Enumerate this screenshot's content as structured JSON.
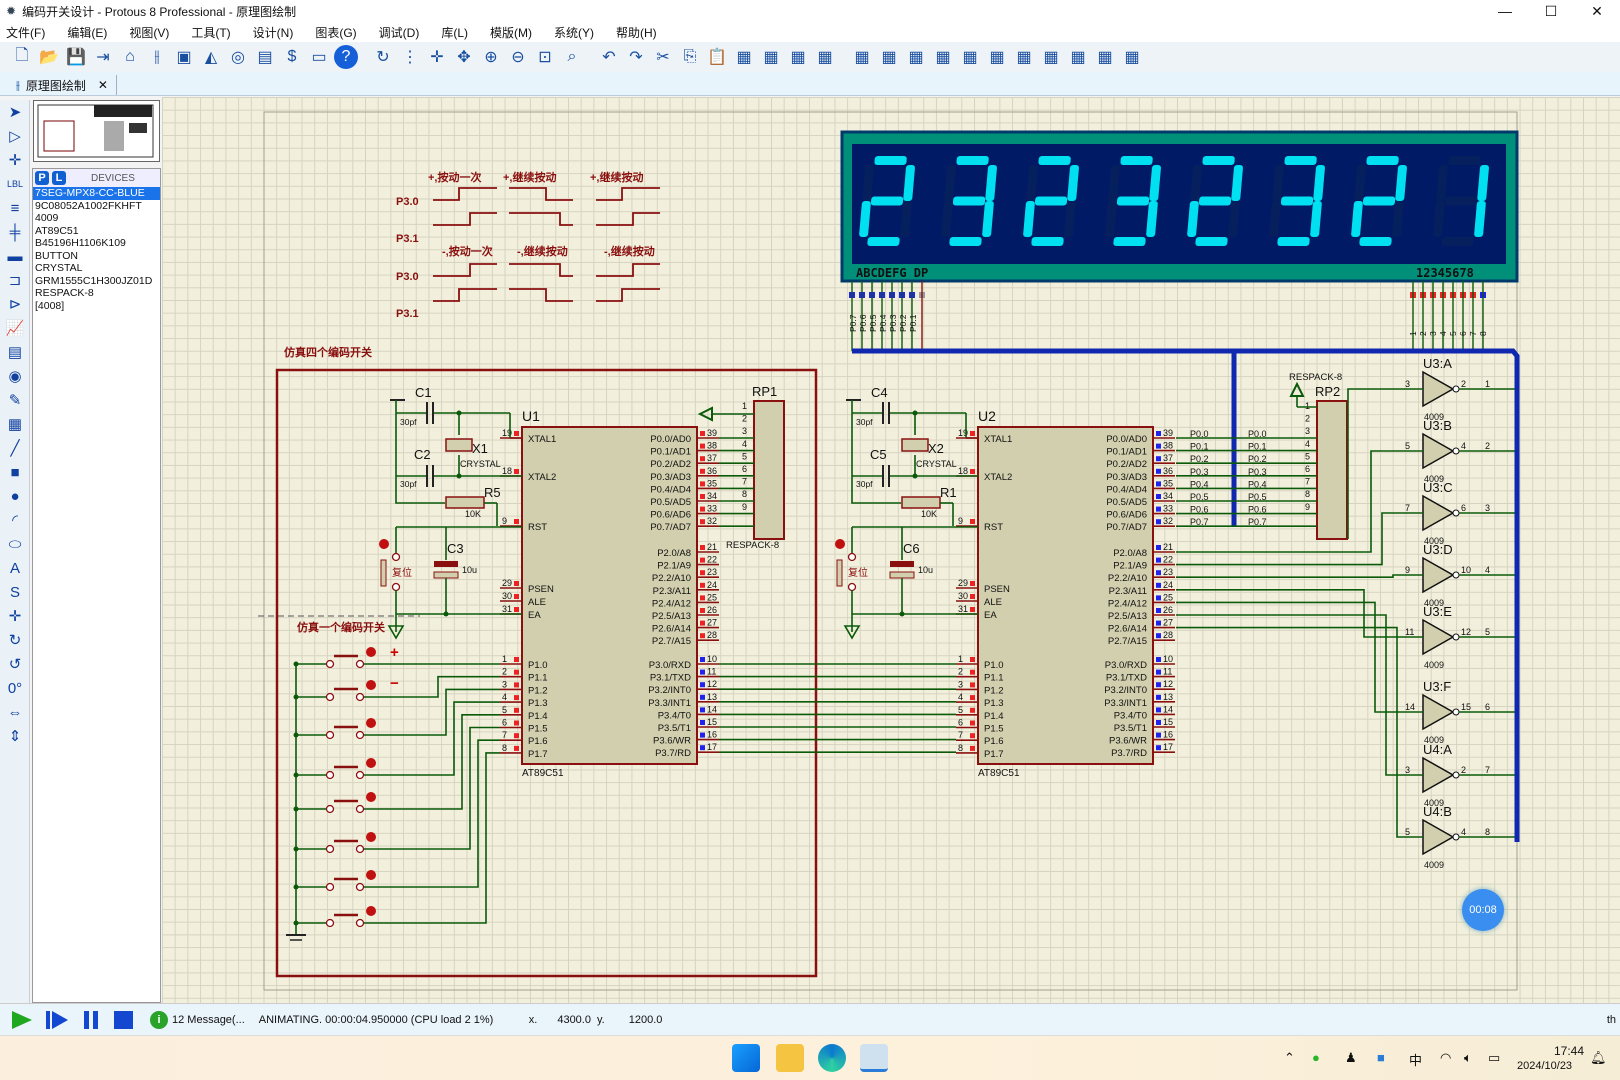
{
  "window": {
    "title": "编码开关设计 - Protous 8 Professional - 原理图绘制",
    "minimize": "—",
    "maximize": "☐",
    "close": "✕"
  },
  "menu": [
    "文件(F)",
    "编辑(E)",
    "视图(V)",
    "工具(T)",
    "设计(N)",
    "图表(G)",
    "调试(D)",
    "库(L)",
    "模版(M)",
    "系统(Y)",
    "帮助(H)"
  ],
  "toolbar_icons": [
    "new-file",
    "open-folder",
    "save",
    "import",
    "home",
    "schematic",
    "pcb",
    "3d-view",
    "gerber",
    "bom",
    "design-explorer",
    "pdf",
    "help",
    "refresh",
    "grid",
    "origin",
    "pan",
    "zoom-in",
    "zoom-out",
    "zoom-all",
    "zoom-area",
    "undo",
    "redo",
    "cut",
    "copy",
    "paste",
    "block-copy",
    "block-move",
    "block-rotate",
    "block-delete",
    "pick-device",
    "make-device",
    "packaging",
    "decompose",
    "wire-autorouter",
    "search",
    "property-assign",
    "new-sheet",
    "remove-sheet",
    "exit-to-parent",
    "netlist"
  ],
  "tab": {
    "label": "原理图绘制",
    "close": "✕"
  },
  "devices": {
    "p": "P",
    "l": "L",
    "title": "DEVICES",
    "items": [
      "7SEG-MPX8-CC-BLUE",
      "9C08052A1002FKHFT",
      "4009",
      "AT89C51",
      "B45196H1106K109",
      "BUTTON",
      "CRYSTAL",
      "GRM1555C1H300JZ01D",
      "RESPACK-8",
      "[4008]"
    ],
    "selected": 0
  },
  "schematic": {
    "wave_labels": {
      "plus_once": "+,按动一次",
      "plus_cont1": "+,继续按动",
      "plus_cont2": "+,继续按动",
      "minus_once": "-,按动一次",
      "minus_cont1": "-,继续按动",
      "minus_cont2": "-,继续按动",
      "p30": "P3.0",
      "p31": "P3.1"
    },
    "box_label": "仿真四个编码开关",
    "single_label": "仿真一个编码开关",
    "plus_sign": "+",
    "minus_sign": "−",
    "display": {
      "digits": "23232321",
      "seg_label": "ABCDEFG  DP",
      "com_label": "12345678",
      "color": "#00e0f0",
      "bg": "#001a66",
      "frame": "#00907a",
      "pin_names": [
        "P0.7",
        "P0.6",
        "P0.5",
        "P0.4",
        "P0.3",
        "P0.2",
        "P0.1"
      ],
      "com_pins": [
        "1",
        "2",
        "3",
        "4",
        "5",
        "6",
        "7",
        "8"
      ]
    },
    "u1": {
      "ref": "U1",
      "part": "AT89C51"
    },
    "u2": {
      "ref": "U2",
      "part": "AT89C51"
    },
    "chip_left": [
      [
        "XTAL1",
        "19"
      ],
      [
        "XTAL2",
        "18"
      ],
      [
        "RST",
        "9"
      ],
      [
        "PSEN",
        "29"
      ],
      [
        "ALE",
        "30"
      ],
      [
        "EA",
        "31"
      ],
      [
        "P1.0",
        "1"
      ],
      [
        "P1.1",
        "2"
      ],
      [
        "P1.2",
        "3"
      ],
      [
        "P1.3",
        "4"
      ],
      [
        "P1.4",
        "5"
      ],
      [
        "P1.5",
        "6"
      ],
      [
        "P1.6",
        "7"
      ],
      [
        "P1.7",
        "8"
      ]
    ],
    "chip_right_p0": [
      [
        "P0.0/AD0",
        "39"
      ],
      [
        "P0.1/AD1",
        "38"
      ],
      [
        "P0.2/AD2",
        "37"
      ],
      [
        "P0.3/AD3",
        "36"
      ],
      [
        "P0.4/AD4",
        "35"
      ],
      [
        "P0.5/AD5",
        "34"
      ],
      [
        "P0.6/AD6",
        "33"
      ],
      [
        "P0.7/AD7",
        "32"
      ]
    ],
    "chip_right_p2": [
      [
        "P2.0/A8",
        "21"
      ],
      [
        "P2.1/A9",
        "22"
      ],
      [
        "P2.2/A10",
        "23"
      ],
      [
        "P2.3/A11",
        "24"
      ],
      [
        "P2.4/A12",
        "25"
      ],
      [
        "P2.5/A13",
        "26"
      ],
      [
        "P2.6/A14",
        "27"
      ],
      [
        "P2.7/A15",
        "28"
      ]
    ],
    "chip_right_p3": [
      [
        "P3.0/RXD",
        "10"
      ],
      [
        "P3.1/TXD",
        "11"
      ],
      [
        "P3.2/INT0",
        "12"
      ],
      [
        "P3.3/INT1",
        "13"
      ],
      [
        "P3.4/T0",
        "14"
      ],
      [
        "P3.5/T1",
        "15"
      ],
      [
        "P3.6/WR",
        "16"
      ],
      [
        "P3.7/RD",
        "17"
      ]
    ],
    "rp1": {
      "ref": "RP1",
      "part": "RESPACK-8"
    },
    "rp2": {
      "ref": "RP2",
      "part": "RESPACK-8"
    },
    "net_p0": [
      "P0.0",
      "P0.1",
      "P0.2",
      "P0.3",
      "P0.4",
      "P0.5",
      "P0.6",
      "P0.7"
    ],
    "left_parts": [
      {
        "ref": "C1",
        "val": "30pf"
      },
      {
        "ref": "C2",
        "val": "30pf"
      },
      {
        "ref": "X1",
        "val": "CRYSTAL"
      },
      {
        "ref": "R5",
        "val": "10K"
      },
      {
        "ref": "C3",
        "val": "10u"
      },
      {
        "ref": "reset",
        "val": "复位"
      }
    ],
    "right_parts": [
      {
        "ref": "C4",
        "val": "30pf"
      },
      {
        "ref": "C5",
        "val": "30pf"
      },
      {
        "ref": "X2",
        "val": "CRYSTAL"
      },
      {
        "ref": "R1",
        "val": "10K"
      },
      {
        "ref": "C6",
        "val": "10u"
      },
      {
        "ref": "reset",
        "val": "复位"
      }
    ],
    "buffers": [
      {
        "ref": "U3:A",
        "in": "3",
        "out": "2",
        "n": "1"
      },
      {
        "ref": "U3:B",
        "in": "5",
        "out": "4",
        "n": "2"
      },
      {
        "ref": "U3:C",
        "in": "7",
        "out": "6",
        "n": "3"
      },
      {
        "ref": "U3:D",
        "in": "9",
        "out": "10",
        "n": "4"
      },
      {
        "ref": "U3:E",
        "in": "11",
        "out": "12",
        "n": "5"
      },
      {
        "ref": "U3:F",
        "in": "14",
        "out": "15",
        "n": "6"
      },
      {
        "ref": "U4:A",
        "in": "3",
        "out": "2",
        "n": "7"
      },
      {
        "ref": "U4:B",
        "in": "5",
        "out": "4",
        "n": "8"
      }
    ],
    "buffer_part": "4009",
    "timer": "00:08"
  },
  "status": {
    "messages": "12 Message(...",
    "animating": "ANIMATING. 00:00:04.950000 (CPU load 2 1%)",
    "x_label": "x.",
    "x": "4300.0",
    "y_label": "y.",
    "y": "1200.0",
    "right": "th"
  },
  "taskbar": {
    "time": "17:44",
    "date": "2024/10/23",
    "ime": "中"
  }
}
